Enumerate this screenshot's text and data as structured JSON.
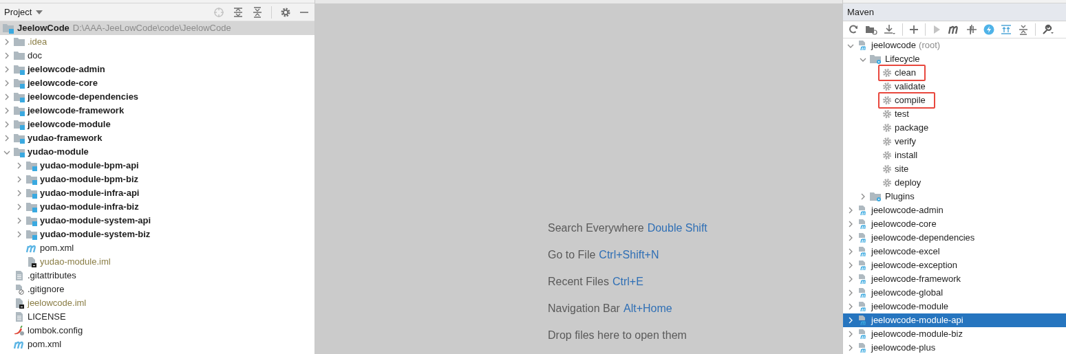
{
  "project_panel": {
    "title": "Project",
    "root": {
      "name": "JeelowCode",
      "path": "D:\\AAA-JeeLowCode\\code\\JeelowCode",
      "kind": "module",
      "selected": true
    },
    "items": [
      {
        "name": ".idea",
        "kind": "folder",
        "excluded": true,
        "expanded": false,
        "selected": false
      },
      {
        "name": "doc",
        "kind": "folder",
        "excluded": false,
        "expanded": false,
        "selected": false
      },
      {
        "name": "jeelowcode-admin",
        "kind": "module",
        "excluded": false,
        "expanded": false,
        "selected": false
      },
      {
        "name": "jeelowcode-core",
        "kind": "module",
        "excluded": false,
        "expanded": false,
        "selected": false
      },
      {
        "name": "jeelowcode-dependencies",
        "kind": "module",
        "excluded": false,
        "expanded": false,
        "selected": false
      },
      {
        "name": "jeelowcode-framework",
        "kind": "module",
        "excluded": false,
        "expanded": false,
        "selected": false
      },
      {
        "name": "jeelowcode-module",
        "kind": "module",
        "excluded": false,
        "expanded": false,
        "selected": false
      },
      {
        "name": "yudao-framework",
        "kind": "module",
        "excluded": false,
        "expanded": false,
        "selected": false
      },
      {
        "name": "yudao-module",
        "kind": "module",
        "excluded": false,
        "expanded": true,
        "selected": false,
        "children": [
          {
            "name": "yudao-module-bpm-api",
            "kind": "module",
            "excluded": false,
            "expanded": false,
            "selected": false
          },
          {
            "name": "yudao-module-bpm-biz",
            "kind": "module",
            "excluded": false,
            "expanded": false,
            "selected": false
          },
          {
            "name": "yudao-module-infra-api",
            "kind": "module",
            "excluded": false,
            "expanded": false,
            "selected": false
          },
          {
            "name": "yudao-module-infra-biz",
            "kind": "module",
            "excluded": false,
            "expanded": false,
            "selected": false
          },
          {
            "name": "yudao-module-system-api",
            "kind": "module",
            "excluded": false,
            "expanded": false,
            "selected": false
          },
          {
            "name": "yudao-module-system-biz",
            "kind": "module",
            "excluded": false,
            "expanded": false,
            "selected": false
          },
          {
            "name": "pom.xml",
            "kind": "maven",
            "excluded": false,
            "selected": false
          },
          {
            "name": "yudao-module.iml",
            "kind": "iml",
            "excluded": true,
            "selected": false
          }
        ]
      },
      {
        "name": ".gitattributes",
        "kind": "text",
        "excluded": false,
        "selected": false
      },
      {
        "name": ".gitignore",
        "kind": "ignore",
        "excluded": false,
        "selected": false
      },
      {
        "name": "jeelowcode.iml",
        "kind": "iml",
        "excluded": true,
        "selected": false
      },
      {
        "name": "LICENSE",
        "kind": "text",
        "excluded": false,
        "selected": false
      },
      {
        "name": "lombok.config",
        "kind": "lombok",
        "excluded": false,
        "selected": false
      },
      {
        "name": "pom.xml",
        "kind": "maven",
        "excluded": false,
        "selected": false
      }
    ]
  },
  "editor_hints": [
    {
      "text": "Search Everywhere",
      "shortcut": "Double Shift"
    },
    {
      "text": "Go to File",
      "shortcut": "Ctrl+Shift+N"
    },
    {
      "text": "Recent Files",
      "shortcut": "Ctrl+E"
    },
    {
      "text": "Navigation Bar",
      "shortcut": "Alt+Home"
    },
    {
      "text": "Drop files here to open them"
    }
  ],
  "maven_panel": {
    "title": "Maven",
    "items": [
      {
        "name": "jeelowcode",
        "suffix": "(root)",
        "kind": "module",
        "expanded": true,
        "selected": false,
        "children": [
          {
            "name": "Lifecycle",
            "kind": "config-folder",
            "expanded": true,
            "selected": false,
            "children": [
              {
                "name": "clean",
                "kind": "goal",
                "marked": true,
                "selected": false
              },
              {
                "name": "validate",
                "kind": "goal",
                "marked": false,
                "selected": false
              },
              {
                "name": "compile",
                "kind": "goal",
                "marked": true,
                "selected": false
              },
              {
                "name": "test",
                "kind": "goal",
                "marked": false,
                "selected": false
              },
              {
                "name": "package",
                "kind": "goal",
                "marked": false,
                "selected": false
              },
              {
                "name": "verify",
                "kind": "goal",
                "marked": false,
                "selected": false
              },
              {
                "name": "install",
                "kind": "goal",
                "marked": false,
                "selected": false
              },
              {
                "name": "site",
                "kind": "goal",
                "marked": false,
                "selected": false
              },
              {
                "name": "deploy",
                "kind": "goal",
                "marked": false,
                "selected": false
              }
            ]
          },
          {
            "name": "Plugins",
            "kind": "config-folder",
            "expanded": false,
            "selected": false
          }
        ]
      },
      {
        "name": "jeelowcode-admin",
        "kind": "module",
        "expanded": false,
        "selected": false
      },
      {
        "name": "jeelowcode-core",
        "kind": "module",
        "expanded": false,
        "selected": false
      },
      {
        "name": "jeelowcode-dependencies",
        "kind": "module",
        "expanded": false,
        "selected": false
      },
      {
        "name": "jeelowcode-excel",
        "kind": "module",
        "expanded": false,
        "selected": false
      },
      {
        "name": "jeelowcode-exception",
        "kind": "module",
        "expanded": false,
        "selected": false
      },
      {
        "name": "jeelowcode-framework",
        "kind": "module",
        "expanded": false,
        "selected": false
      },
      {
        "name": "jeelowcode-global",
        "kind": "module",
        "expanded": false,
        "selected": false
      },
      {
        "name": "jeelowcode-module",
        "kind": "module",
        "expanded": false,
        "selected": false
      },
      {
        "name": "jeelowcode-module-api",
        "kind": "module",
        "expanded": false,
        "selected": true
      },
      {
        "name": "jeelowcode-module-biz",
        "kind": "module",
        "expanded": false,
        "selected": false
      },
      {
        "name": "jeelowcode-plus",
        "kind": "module",
        "expanded": false,
        "selected": false
      }
    ]
  }
}
